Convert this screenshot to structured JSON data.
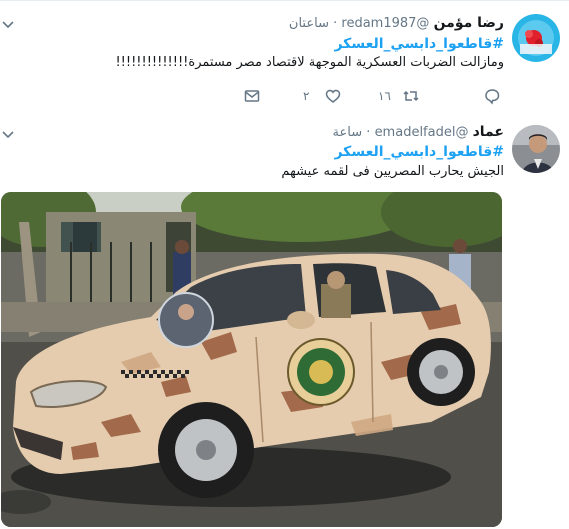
{
  "tweets": [
    {
      "name": "رضا مؤمن",
      "handle": "@redam1987",
      "separator": "·",
      "time": "ساعتان",
      "hashtag": "#قاطعوا_دابسي_العسكر",
      "text": "ومازالت الضربات العسكرية الموجهة لاقتصاد مصر مستمرة!!!!!!!!!!!!!!",
      "reply_count": "",
      "retweet_count": "١٦",
      "like_count": "٢",
      "icons": [
        "reply-icon",
        "retweet-icon",
        "like-icon",
        "dm-icon",
        "caret-down-icon"
      ]
    },
    {
      "name": "عماد",
      "handle": "@emadelfadel",
      "separator": "·",
      "time": "ساعة",
      "hashtag": "#قاطعوا_دابسي_العسكر",
      "text": "الجيش يحارب المصريين فى لقمه عيشهم",
      "icons": [
        "caret-down-icon"
      ]
    }
  ],
  "colors": {
    "link": "#1da1f2",
    "secondary": "#657786",
    "divider": "#e6ecf0"
  }
}
